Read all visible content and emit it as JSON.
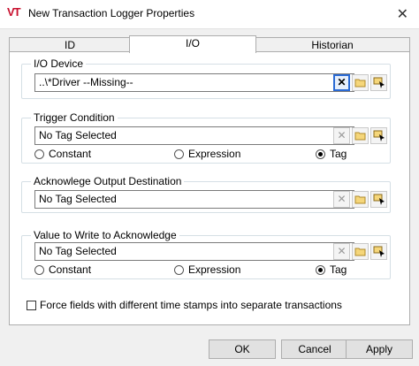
{
  "window": {
    "logo": "VT",
    "title": "New Transaction Logger Properties",
    "close": "✕"
  },
  "tabs": [
    {
      "label": "ID"
    },
    {
      "label": "I/O"
    },
    {
      "label": "Historian"
    }
  ],
  "io_device": {
    "label": "I/O Device",
    "value": "..\\*Driver   --Missing--"
  },
  "trigger": {
    "label": "Trigger Condition",
    "value": "No Tag Selected",
    "options": [
      "Constant",
      "Expression",
      "Tag"
    ],
    "selected": "Tag"
  },
  "ack_output": {
    "label": "Acknowlege Output Destination",
    "value": "No Tag Selected"
  },
  "ack_value": {
    "label": "Value to Write to Acknowledge",
    "value": "No Tag Selected",
    "options": [
      "Constant",
      "Expression",
      "Tag"
    ],
    "selected": "Tag"
  },
  "force_fields": {
    "label": "Force fields with different time stamps into separate transactions",
    "checked": false
  },
  "buttons": {
    "ok": "OK",
    "cancel": "Cancel",
    "apply": "Apply"
  },
  "icons": {
    "clear": "x-icon",
    "browse": "folder-icon",
    "select": "pick-tag-icon"
  },
  "colors": {
    "accent": "#2a6ad4",
    "logo": "#c8102e"
  }
}
